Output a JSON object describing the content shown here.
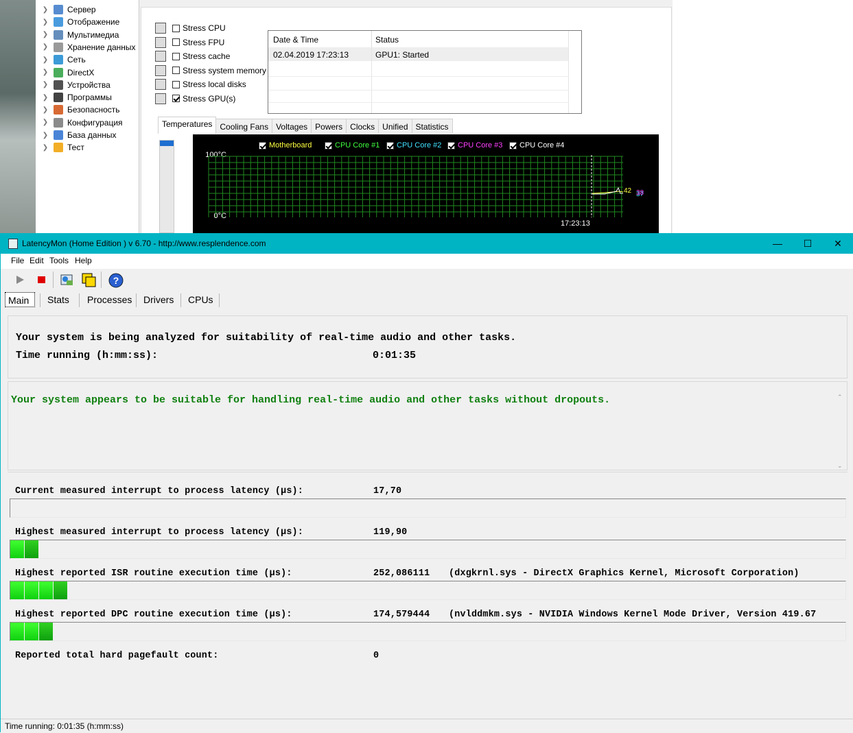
{
  "tree": {
    "items": [
      {
        "label": "Сервер",
        "icon": "server-icon"
      },
      {
        "label": "Отображение",
        "icon": "display-icon"
      },
      {
        "label": "Мультимедиа",
        "icon": "multimedia-icon"
      },
      {
        "label": "Хранение данных",
        "icon": "storage-icon"
      },
      {
        "label": "Сеть",
        "icon": "network-icon"
      },
      {
        "label": "DirectX",
        "icon": "directx-icon"
      },
      {
        "label": "Устройства",
        "icon": "devices-icon"
      },
      {
        "label": "Программы",
        "icon": "programs-icon"
      },
      {
        "label": "Безопасность",
        "icon": "security-icon"
      },
      {
        "label": "Конфигурация",
        "icon": "config-icon"
      },
      {
        "label": "База данных",
        "icon": "database-icon"
      },
      {
        "label": "Тест",
        "icon": "test-icon"
      }
    ]
  },
  "stress": {
    "items": [
      {
        "label": "Stress CPU",
        "checked": false,
        "icon": "cpu-icon"
      },
      {
        "label": "Stress FPU",
        "checked": false,
        "icon": "fpu-icon"
      },
      {
        "label": "Stress cache",
        "checked": false,
        "icon": "cache-icon"
      },
      {
        "label": "Stress system memory",
        "checked": false,
        "icon": "memory-icon"
      },
      {
        "label": "Stress local disks",
        "checked": false,
        "icon": "disk-icon"
      },
      {
        "label": "Stress GPU(s)",
        "checked": true,
        "icon": "gpu-icon"
      }
    ],
    "log": {
      "col_datetime": "Date & Time",
      "col_status": "Status",
      "rows": [
        {
          "datetime": "02.04.2019 17:23:13",
          "status": "GPU1: Started"
        }
      ]
    }
  },
  "aida_tabs": [
    "Temperatures",
    "Cooling Fans",
    "Voltages",
    "Powers",
    "Clocks",
    "Unified",
    "Statistics"
  ],
  "temp_graph": {
    "legend": [
      {
        "label": "Motherboard",
        "color": "#ffff40"
      },
      {
        "label": "CPU Core #1",
        "color": "#40ff40"
      },
      {
        "label": "CPU Core #2",
        "color": "#40e0ff"
      },
      {
        "label": "CPU Core #3",
        "color": "#ff40ff"
      },
      {
        "label": "CPU Core #4",
        "color": "#ffffff"
      }
    ],
    "y_max_label": "100°C",
    "y_min_label": "0°C",
    "time_label": "17:23:13",
    "val_a": "42",
    "val_b": "37",
    "val_c": "38"
  },
  "latencymon": {
    "title": "LatencyMon  (Home Edition )  v 6.70 - http://www.resplendence.com",
    "menu": [
      "File",
      "Edit",
      "Tools",
      "Help"
    ],
    "tabs": [
      "Main",
      "Stats",
      "Processes",
      "Drivers",
      "CPUs"
    ],
    "analyzing": "Your system is being analyzed for suitability of real-time audio and other tasks.",
    "time_running_label": "Time running (h:mm:ss):",
    "time_running_value": "0:01:35",
    "verdict": "Your system appears to be suitable for handling real-time audio and other tasks without dropouts.",
    "metrics": [
      {
        "label": "Current measured interrupt to process latency (µs):",
        "value": "17,70",
        "extra": "",
        "bar_level": 0
      },
      {
        "label": "Highest measured interrupt to process latency (µs):",
        "value": "119,90",
        "extra": "",
        "bar_level": 2
      },
      {
        "label": "Highest reported ISR routine execution time (µs):",
        "value": "252,086111",
        "extra": "(dxgkrnl.sys - DirectX Graphics Kernel, Microsoft Corporation)",
        "bar_level": 4
      },
      {
        "label": "Highest reported DPC routine execution time (µs):",
        "value": "174,579444",
        "extra": "(nvlddmkm.sys - NVIDIA Windows Kernel Mode Driver, Version 419.67",
        "bar_level": 3
      },
      {
        "label": "Reported total hard pagefault count:",
        "value": "0",
        "extra": "",
        "bar_level": null
      }
    ],
    "status_bar": "Time running: 0:01:35  (h:mm:ss)",
    "colors": {
      "title_bar": "#00b4c4",
      "verdict_text": "#108010",
      "bar_green": "#20e020"
    }
  }
}
